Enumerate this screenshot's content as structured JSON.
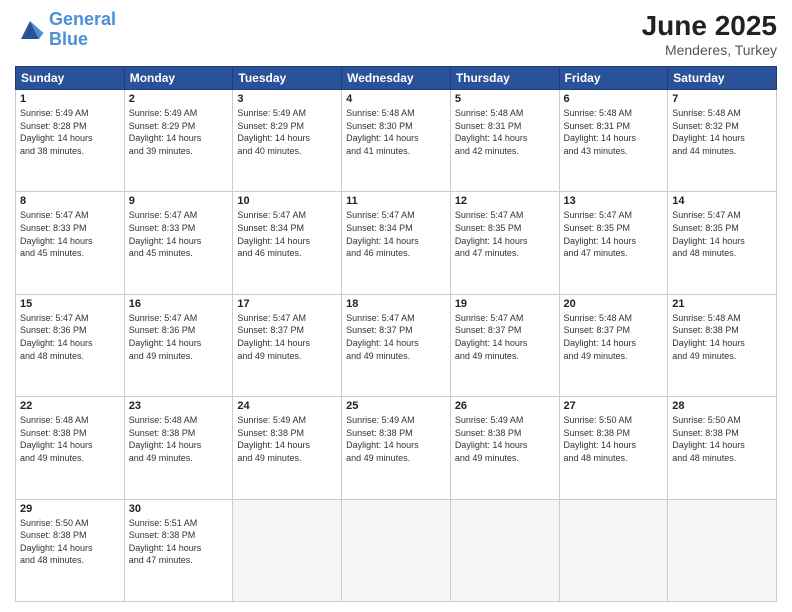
{
  "header": {
    "logo_line1": "General",
    "logo_line2": "Blue",
    "month": "June 2025",
    "location": "Menderes, Turkey"
  },
  "weekdays": [
    "Sunday",
    "Monday",
    "Tuesday",
    "Wednesday",
    "Thursday",
    "Friday",
    "Saturday"
  ],
  "weeks": [
    [
      {
        "day": "1",
        "info": "Sunrise: 5:49 AM\nSunset: 8:28 PM\nDaylight: 14 hours\nand 38 minutes."
      },
      {
        "day": "2",
        "info": "Sunrise: 5:49 AM\nSunset: 8:29 PM\nDaylight: 14 hours\nand 39 minutes."
      },
      {
        "day": "3",
        "info": "Sunrise: 5:49 AM\nSunset: 8:29 PM\nDaylight: 14 hours\nand 40 minutes."
      },
      {
        "day": "4",
        "info": "Sunrise: 5:48 AM\nSunset: 8:30 PM\nDaylight: 14 hours\nand 41 minutes."
      },
      {
        "day": "5",
        "info": "Sunrise: 5:48 AM\nSunset: 8:31 PM\nDaylight: 14 hours\nand 42 minutes."
      },
      {
        "day": "6",
        "info": "Sunrise: 5:48 AM\nSunset: 8:31 PM\nDaylight: 14 hours\nand 43 minutes."
      },
      {
        "day": "7",
        "info": "Sunrise: 5:48 AM\nSunset: 8:32 PM\nDaylight: 14 hours\nand 44 minutes."
      }
    ],
    [
      {
        "day": "8",
        "info": "Sunrise: 5:47 AM\nSunset: 8:33 PM\nDaylight: 14 hours\nand 45 minutes."
      },
      {
        "day": "9",
        "info": "Sunrise: 5:47 AM\nSunset: 8:33 PM\nDaylight: 14 hours\nand 45 minutes."
      },
      {
        "day": "10",
        "info": "Sunrise: 5:47 AM\nSunset: 8:34 PM\nDaylight: 14 hours\nand 46 minutes."
      },
      {
        "day": "11",
        "info": "Sunrise: 5:47 AM\nSunset: 8:34 PM\nDaylight: 14 hours\nand 46 minutes."
      },
      {
        "day": "12",
        "info": "Sunrise: 5:47 AM\nSunset: 8:35 PM\nDaylight: 14 hours\nand 47 minutes."
      },
      {
        "day": "13",
        "info": "Sunrise: 5:47 AM\nSunset: 8:35 PM\nDaylight: 14 hours\nand 47 minutes."
      },
      {
        "day": "14",
        "info": "Sunrise: 5:47 AM\nSunset: 8:35 PM\nDaylight: 14 hours\nand 48 minutes."
      }
    ],
    [
      {
        "day": "15",
        "info": "Sunrise: 5:47 AM\nSunset: 8:36 PM\nDaylight: 14 hours\nand 48 minutes."
      },
      {
        "day": "16",
        "info": "Sunrise: 5:47 AM\nSunset: 8:36 PM\nDaylight: 14 hours\nand 49 minutes."
      },
      {
        "day": "17",
        "info": "Sunrise: 5:47 AM\nSunset: 8:37 PM\nDaylight: 14 hours\nand 49 minutes."
      },
      {
        "day": "18",
        "info": "Sunrise: 5:47 AM\nSunset: 8:37 PM\nDaylight: 14 hours\nand 49 minutes."
      },
      {
        "day": "19",
        "info": "Sunrise: 5:47 AM\nSunset: 8:37 PM\nDaylight: 14 hours\nand 49 minutes."
      },
      {
        "day": "20",
        "info": "Sunrise: 5:48 AM\nSunset: 8:37 PM\nDaylight: 14 hours\nand 49 minutes."
      },
      {
        "day": "21",
        "info": "Sunrise: 5:48 AM\nSunset: 8:38 PM\nDaylight: 14 hours\nand 49 minutes."
      }
    ],
    [
      {
        "day": "22",
        "info": "Sunrise: 5:48 AM\nSunset: 8:38 PM\nDaylight: 14 hours\nand 49 minutes."
      },
      {
        "day": "23",
        "info": "Sunrise: 5:48 AM\nSunset: 8:38 PM\nDaylight: 14 hours\nand 49 minutes."
      },
      {
        "day": "24",
        "info": "Sunrise: 5:49 AM\nSunset: 8:38 PM\nDaylight: 14 hours\nand 49 minutes."
      },
      {
        "day": "25",
        "info": "Sunrise: 5:49 AM\nSunset: 8:38 PM\nDaylight: 14 hours\nand 49 minutes."
      },
      {
        "day": "26",
        "info": "Sunrise: 5:49 AM\nSunset: 8:38 PM\nDaylight: 14 hours\nand 49 minutes."
      },
      {
        "day": "27",
        "info": "Sunrise: 5:50 AM\nSunset: 8:38 PM\nDaylight: 14 hours\nand 48 minutes."
      },
      {
        "day": "28",
        "info": "Sunrise: 5:50 AM\nSunset: 8:38 PM\nDaylight: 14 hours\nand 48 minutes."
      }
    ],
    [
      {
        "day": "29",
        "info": "Sunrise: 5:50 AM\nSunset: 8:38 PM\nDaylight: 14 hours\nand 48 minutes."
      },
      {
        "day": "30",
        "info": "Sunrise: 5:51 AM\nSunset: 8:38 PM\nDaylight: 14 hours\nand 47 minutes."
      },
      {
        "day": "",
        "info": ""
      },
      {
        "day": "",
        "info": ""
      },
      {
        "day": "",
        "info": ""
      },
      {
        "day": "",
        "info": ""
      },
      {
        "day": "",
        "info": ""
      }
    ]
  ]
}
